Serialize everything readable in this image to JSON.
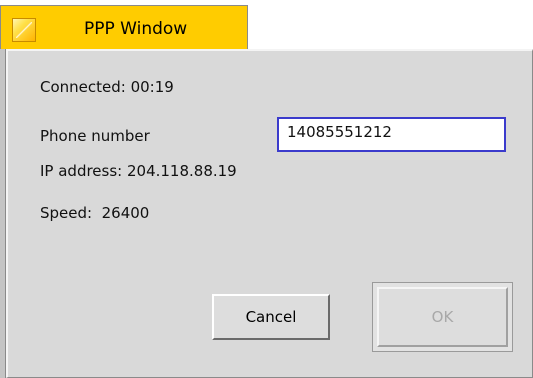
{
  "window": {
    "title": "PPP Window",
    "accent_color": "#ffcc00",
    "input_border_color": "#3b3bcc"
  },
  "status": {
    "connected": "Connected: 00:19",
    "phone_label": "Phone number",
    "phone_value": "14085551212",
    "ip_address": "IP address: 204.118.88.19",
    "speed": "Speed:  26400"
  },
  "buttons": {
    "cancel_label": "Cancel",
    "ok_label": "OK",
    "ok_enabled": false
  },
  "icons": {
    "app_icon": "ppp-window-icon"
  }
}
